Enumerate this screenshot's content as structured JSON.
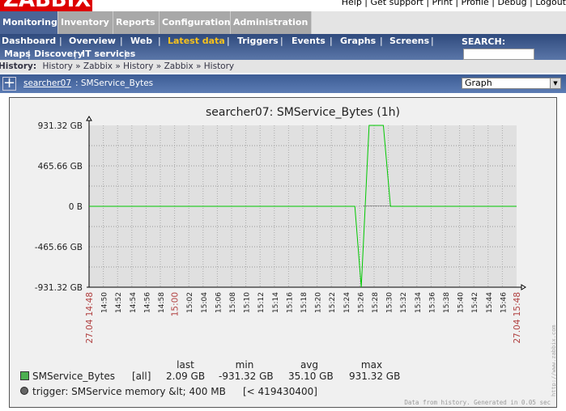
{
  "logo": "ZABBIX",
  "top_links": "Help | Get support | Print | Profile | Debug | Logout",
  "main_menu": [
    "Monitoring",
    "Inventory",
    "Reports",
    "Configuration",
    "Administration"
  ],
  "sub_menu": [
    "Dashboard",
    "Overview",
    "Web",
    "Latest data",
    "Triggers",
    "Events",
    "Graphs",
    "Screens",
    "Maps",
    "Discovery",
    "IT services"
  ],
  "search_label": "SEARCH:",
  "history": {
    "label": "History:",
    "items": [
      "History",
      "Zabbix",
      "History",
      "Zabbix",
      "History"
    ]
  },
  "header": {
    "host": "searcher07",
    "item": ": SMService_Bytes",
    "select": "Graph"
  },
  "chart_data": {
    "type": "line",
    "title": "searcher07: SMService_Bytes  (1h)",
    "ylim": [
      -931.32,
      931.32
    ],
    "yticks": [
      "931.32 GB",
      "465.66 GB",
      "0 B",
      "-465.66 GB",
      "-931.32 GB"
    ],
    "ytick_values": [
      931.32,
      465.66,
      0,
      -465.66,
      -931.32
    ],
    "xlim_minutes": [
      0,
      60
    ],
    "x_start_label": "27.04 14:48",
    "x_end_label": "27.04 15:48",
    "xticks": [
      "14:50",
      "14:52",
      "14:54",
      "14:56",
      "14:58",
      "15:00",
      "15:02",
      "15:04",
      "15:06",
      "15:08",
      "15:10",
      "15:12",
      "15:14",
      "15:16",
      "15:18",
      "15:20",
      "15:22",
      "15:24",
      "15:26",
      "15:28",
      "15:30",
      "15:32",
      "15:34",
      "15:36",
      "15:38",
      "15:40",
      "15:42",
      "15:44",
      "15:46"
    ],
    "series": [
      {
        "name": "SMService_Bytes",
        "color": "#00c800",
        "x_minutes": [
          0,
          37.3,
          38.2,
          39.3,
          41.3,
          42.3,
          60
        ],
        "values": [
          0,
          0,
          -931.32,
          931.32,
          931.32,
          0,
          0
        ]
      }
    ],
    "legend": {
      "headers": [
        "last",
        "min",
        "avg",
        "max"
      ],
      "name": "SMService_Bytes",
      "scope": "[all]",
      "last": "2.09 GB",
      "min": "-931.32 GB",
      "avg": "35.10 GB",
      "max": "931.32 GB",
      "swatch": "#4caf50"
    },
    "trigger": {
      "label": "trigger: SMService memory &lt; 400 MB",
      "value": "[< 419430400]"
    },
    "footer": "Data from history. Generated in 0.05 sec",
    "watermark": "http://www.zabbix.com"
  }
}
